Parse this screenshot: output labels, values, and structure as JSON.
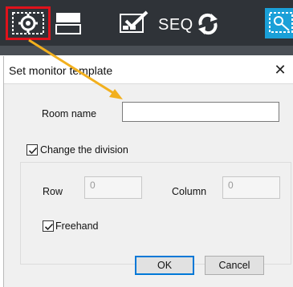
{
  "toolbar": {
    "seq_label": "SEQ",
    "icons": {
      "settings": "settings-gear-icon",
      "layout": "layout-icon",
      "grid": "grid-check-icon",
      "cycle": "cycle-icon",
      "cut": "monitor-cut-icon"
    },
    "highlight_color": "#e0121b",
    "accent_color": "#1aa0d8"
  },
  "dialog": {
    "title": "Set monitor template",
    "close_label": "✕",
    "room_name": {
      "label": "Room name",
      "value": ""
    },
    "change_division": {
      "label": "Change the division",
      "checked": true
    },
    "row": {
      "label": "Row",
      "value": "0"
    },
    "column": {
      "label": "Column",
      "value": "0"
    },
    "freehand": {
      "label": "Freehand",
      "checked": true
    },
    "ok_label": "OK",
    "cancel_label": "Cancel"
  },
  "annotation": {
    "arrow_color": "#f2b01e"
  }
}
